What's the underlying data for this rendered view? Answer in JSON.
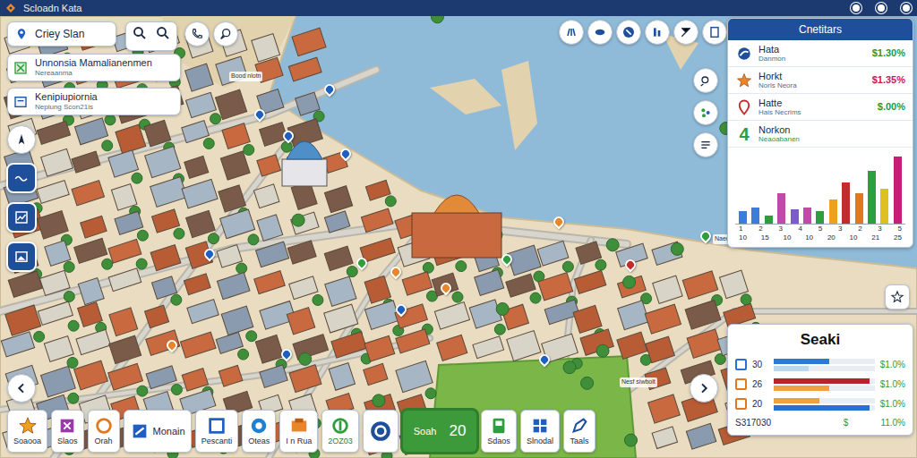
{
  "window": {
    "title": "Scloadn Kata"
  },
  "search": {
    "value": "Criey Slan"
  },
  "panels": [
    {
      "title": "Unnonsia Mamalianenmen",
      "subtitle": "Nereaanma"
    },
    {
      "title": "Kenipiupiornia",
      "subtitle": "Nepiung Scon21is"
    }
  ],
  "map": {
    "labels": [
      "Bood nlotn",
      "Nesf siwbolt",
      "Naeop Scwat"
    ],
    "pins": [
      {
        "color": "#1f5fbf"
      },
      {
        "color": "#1f5fbf"
      },
      {
        "color": "#1f5fbf"
      },
      {
        "color": "#2e9e3e"
      },
      {
        "color": "#e8862a"
      },
      {
        "color": "#1f5fbf"
      },
      {
        "color": "#e8862a"
      },
      {
        "color": "#2e9e3e"
      },
      {
        "color": "#e8862a"
      },
      {
        "color": "#c42b2b"
      },
      {
        "color": "#2e9e3e"
      },
      {
        "color": "#1f5fbf"
      },
      {
        "color": "#e8862a"
      },
      {
        "color": "#1f5fbf"
      },
      {
        "color": "#1f5fbf"
      },
      {
        "color": "#1f5fbf"
      }
    ]
  },
  "competitors": {
    "title": "Cnetitars",
    "items": [
      {
        "kind": "dot",
        "name": "Hata",
        "sub": "Danmon",
        "value": "$1.30%",
        "color": "#1f9a3a"
      },
      {
        "kind": "star",
        "name": "Horkt",
        "sub": "Norls Neora",
        "value": "$1.35%",
        "color": "#c2185b"
      },
      {
        "kind": "pin",
        "name": "Hatte",
        "sub": "Hais Necrims",
        "value": "$.00%",
        "color": "#1f9a3a"
      },
      {
        "kind": "glyph",
        "glyph": "4",
        "name": "Norkon",
        "sub": "Neaoabanen",
        "value": "",
        "color": "#1f9a3a"
      }
    ]
  },
  "chart": {
    "values": [
      12,
      16,
      8,
      30,
      14,
      16,
      12,
      24,
      40,
      30,
      52,
      34,
      66
    ],
    "colors": [
      "#3b7dd8",
      "#3b7dd8",
      "#2e9e3e",
      "#c04aa8",
      "#7a5ccc",
      "#c04aa8",
      "#2e9e3e",
      "#f0a020",
      "#c42b2b",
      "#e07820",
      "#2e9e3e",
      "#e0c020",
      "#c4207a"
    ],
    "ticks_top": [
      "1",
      "2",
      "3",
      "4",
      "5",
      "3",
      "2",
      "3",
      "5"
    ],
    "ticks_bottom": [
      "10",
      "15",
      "10",
      "10",
      "20",
      "10",
      "21",
      "25"
    ]
  },
  "stats": {
    "title": "Seaki",
    "rows": [
      {
        "label": "30",
        "value": "$1.0%",
        "color": "#2a6fd6",
        "bars": [
          {
            "level": 0.55,
            "color": "#2a7ad6"
          },
          {
            "level": 0.35,
            "color": "#bcd8ee"
          }
        ]
      },
      {
        "label": "26",
        "value": "$1.0%",
        "color": "#e07820",
        "bars": [
          {
            "level": 0.95,
            "color": "#b8242c"
          },
          {
            "level": 0.55,
            "color": "#f0a040"
          }
        ]
      },
      {
        "label": "20",
        "value": "$1.0%",
        "color": "#e07820",
        "bars": [
          {
            "level": 0.45,
            "color": "#f0a040"
          },
          {
            "level": 0.95,
            "color": "#2a6fd6"
          }
        ]
      }
    ],
    "footer": {
      "label": "S317030",
      "symbol": "$",
      "value": "11.0%"
    }
  },
  "toolbar": [
    {
      "kind": "stacked",
      "label": "Soaooa",
      "selected": false
    },
    {
      "kind": "stacked",
      "label": "Slaos",
      "selected": false
    },
    {
      "kind": "stacked",
      "label": "Orah",
      "selected": false
    },
    {
      "kind": "inline",
      "label": "Monain",
      "selected": false
    },
    {
      "kind": "stacked",
      "label": "Pescanti",
      "selected": false
    },
    {
      "kind": "stacked",
      "label": "Oteas",
      "selected": false
    },
    {
      "kind": "stacked",
      "label": "I n Rua",
      "selected": false
    },
    {
      "kind": "stacked",
      "label": "2OZ03",
      "selected": false
    },
    {
      "kind": "icon-only",
      "selected": false
    },
    {
      "kind": "highlight",
      "label": "Soah",
      "value": "20",
      "selected": true
    },
    {
      "kind": "stacked",
      "label": "Sdaos",
      "selected": false
    },
    {
      "kind": "stacked",
      "label": "Slnodal",
      "selected": false
    },
    {
      "kind": "stacked",
      "label": "Taals",
      "selected": false
    }
  ]
}
